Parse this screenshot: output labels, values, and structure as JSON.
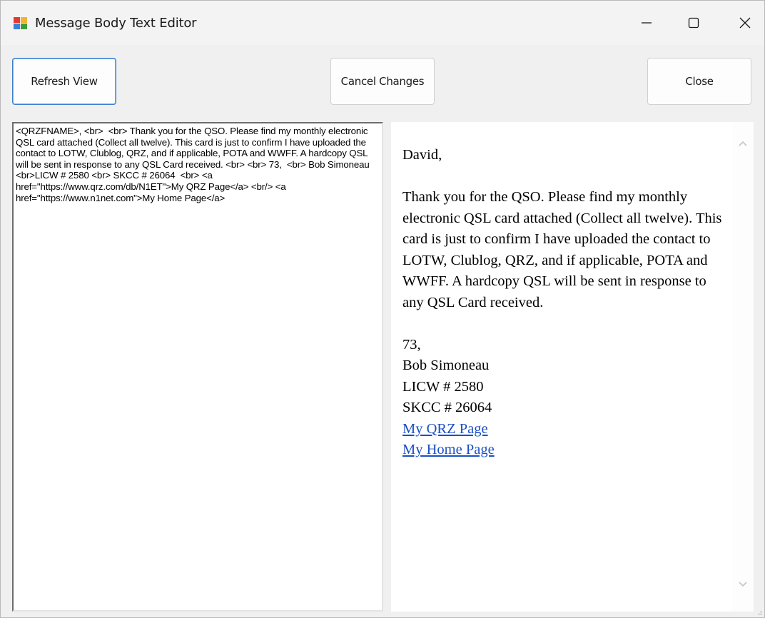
{
  "window": {
    "title": "Message Body Text Editor",
    "icons": {
      "app": "form-app-icon",
      "minimize": "minimize-icon",
      "maximize": "maximize-icon",
      "close": "close-icon"
    }
  },
  "toolbar": {
    "refresh_label": "Refresh View",
    "cancel_label": "Cancel Changes",
    "close_label": "Close"
  },
  "editor": {
    "source_text": "<QRZFNAME>, <br>  <br> Thank you for the QSO. Please find my monthly electronic QSL card attached (Collect all twelve). This card is just to confirm I have uploaded the contact to LOTW, Clublog, QRZ, and if applicable, POTA and WWFF. A hardcopy QSL will be sent in response to any QSL Card received. <br> <br> 73,  <br> Bob Simoneau  <br>LICW # 2580 <br> SKCC # 26064  <br> <a href=\"https://www.qrz.com/db/N1ET\">My QRZ Page</a> <br/> <a href=\"https://www.n1net.com\">My Home Page</a>"
  },
  "preview": {
    "greeting": "David,",
    "body": "Thank you for the QSO. Please find my monthly electronic QSL card attached (Collect all twelve). This card is just to confirm I have uploaded the contact to LOTW, Clublog, QRZ, and if applicable, POTA and WWFF. A hardcopy QSL will be sent in response to any QSL Card received.",
    "signoff": "73,",
    "name": "Bob Simoneau",
    "licw": "LICW # 2580",
    "skcc": "SKCC # 26064",
    "link_qrz": "My QRZ Page",
    "link_home": "My Home Page"
  },
  "colors": {
    "link": "#1a4fc4",
    "focus_border": "#3c7fd0",
    "window_bg": "#f0f0f0"
  }
}
